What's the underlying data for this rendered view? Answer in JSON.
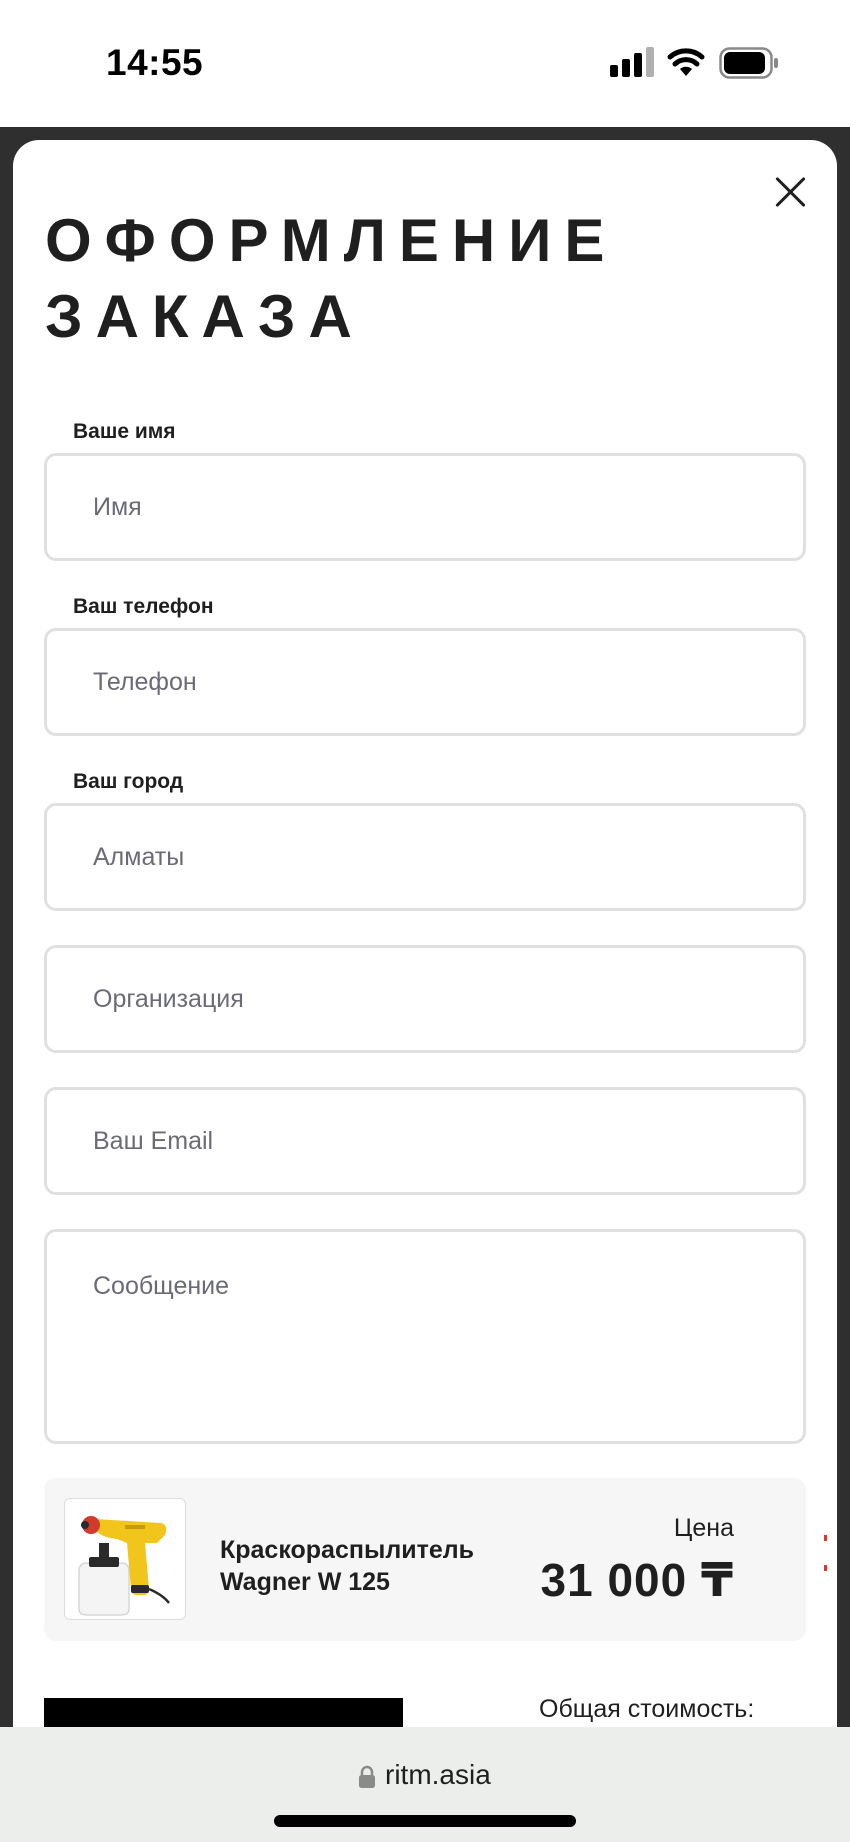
{
  "status_bar": {
    "time": "14:55",
    "icons": [
      "signal-icon",
      "wifi-icon",
      "battery-icon"
    ]
  },
  "modal": {
    "title": "ОФОРМЛЕНИЕ ЗАКАЗА",
    "close_icon": "close-icon"
  },
  "form": {
    "name": {
      "label": "Ваше имя",
      "placeholder": "Имя"
    },
    "phone": {
      "label": "Ваш телефон",
      "placeholder": "Телефон"
    },
    "city": {
      "label": "Ваш город",
      "placeholder": "Алматы"
    },
    "organization": {
      "placeholder": "Организация"
    },
    "email": {
      "placeholder": "Ваш Email"
    },
    "message": {
      "placeholder": "Сообщение"
    }
  },
  "product": {
    "name": "Краскораспылитель Wagner W 125",
    "price_label": "Цена",
    "price": "31 000 ₸",
    "image_icon": "spray-gun-image"
  },
  "summary": {
    "total_label": "Общая стоимость:"
  },
  "browser": {
    "url": "ritm.asia",
    "lock_icon": "lock-icon"
  },
  "colors": {
    "accent_yellow": "#f2c51d",
    "field_border": "#e0e0e0",
    "card_bg": "#f6f6f6"
  }
}
